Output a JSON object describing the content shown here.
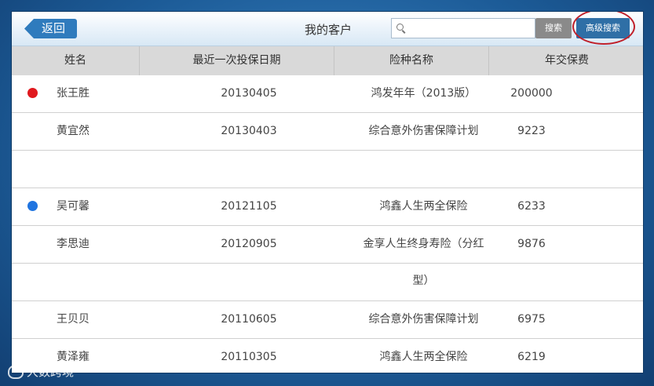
{
  "header": {
    "back_label": "返回",
    "title": "我的客户",
    "search_placeholder": "",
    "search_label": "搜索",
    "advanced_search_label": "高级搜索"
  },
  "table": {
    "columns": [
      "姓名",
      "最近一次投保日期",
      "险种名称",
      "年交保费"
    ],
    "rows": [
      {
        "name": "张王胜",
        "date": "20130405",
        "plan": "鸿发年年（2013版）",
        "fee": "200000",
        "dot": "#e0191e"
      },
      {
        "name": "黄宜然",
        "date": "20130403",
        "plan": "综合意外伤害保障计划",
        "fee": "9223",
        "dot": ""
      },
      {
        "name": "",
        "date": "",
        "plan": "",
        "fee": "",
        "dot": ""
      },
      {
        "name": "吴可馨",
        "date": "20121105",
        "plan": "鸿鑫人生两全保险",
        "fee": "6233",
        "dot": "#1f74e0"
      },
      {
        "name": "李思迪",
        "date": "20120905",
        "plan": "金享人生终身寿险（分红型）",
        "fee": "9876",
        "dot": ""
      },
      {
        "name": "",
        "date": "",
        "plan": "",
        "fee": "",
        "dot": ""
      },
      {
        "name": "王贝贝",
        "date": "20110605",
        "plan": "综合意外伤害保障计划",
        "fee": "6975",
        "dot": ""
      },
      {
        "name": "黄泽雍",
        "date": "20110305",
        "plan": "鸿鑫人生两全保险",
        "fee": "6219",
        "dot": ""
      }
    ]
  },
  "watermark": "大数跨境",
  "colors": {
    "accent": "#2f6fa6",
    "highlight_ring": "#c0202a",
    "header_bg": "#d9d9d9"
  }
}
